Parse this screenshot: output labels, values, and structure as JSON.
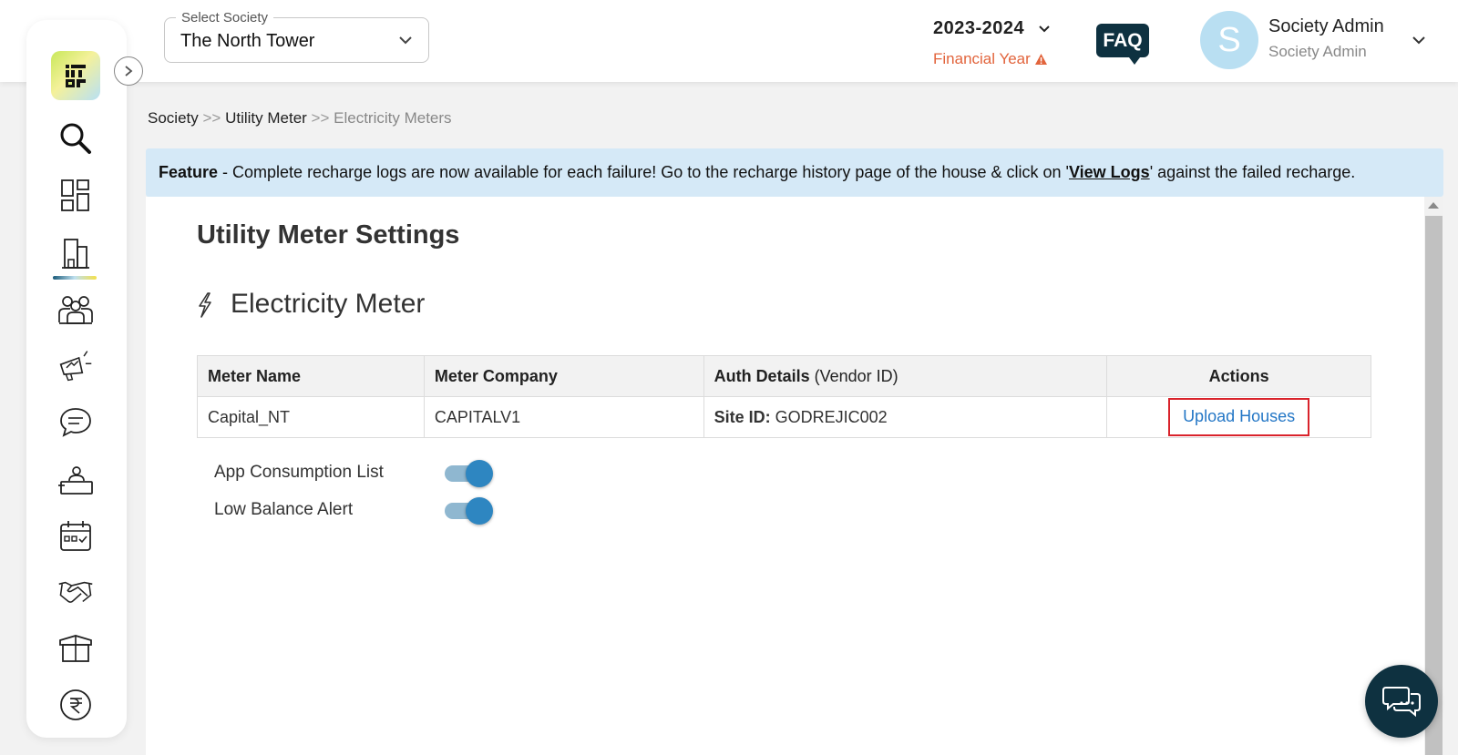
{
  "header": {
    "society_select": {
      "legend": "Select Society",
      "value": "The North Tower"
    },
    "financial_year": {
      "value": "2023-2024",
      "label": "Financial Year"
    },
    "faq_label": "FAQ",
    "user": {
      "initial": "S",
      "name": "Society Admin",
      "role": "Society Admin"
    }
  },
  "sidebar": {
    "items": [
      {
        "icon": "search-icon"
      },
      {
        "icon": "dashboard-icon"
      },
      {
        "icon": "building-icon",
        "active": true
      },
      {
        "icon": "people-icon"
      },
      {
        "icon": "megaphone-icon"
      },
      {
        "icon": "chat-icon"
      },
      {
        "icon": "reception-icon"
      },
      {
        "icon": "calendar-icon"
      },
      {
        "icon": "handshake-icon"
      },
      {
        "icon": "box-icon"
      },
      {
        "icon": "rupee-icon"
      }
    ]
  },
  "breadcrumb": {
    "items": [
      "Society",
      "Utility Meter",
      "Electricity Meters"
    ],
    "separator": ">>"
  },
  "banner": {
    "prefix": "Feature",
    "text_before": " - Complete recharge logs are now available for each failure! Go to the recharge history page of the house & click on '",
    "link": "View Logs",
    "text_after": "' against the failed recharge."
  },
  "page": {
    "title": "Utility Meter Settings",
    "section_title": "Electricity Meter"
  },
  "table": {
    "headers": {
      "meter_name": "Meter Name",
      "meter_company": "Meter Company",
      "auth_details": "Auth Details",
      "auth_details_suffix": "(Vendor ID)",
      "actions": "Actions"
    },
    "rows": [
      {
        "meter_name": "Capital_NT",
        "meter_company": "CAPITALV1",
        "site_label": "Site ID:",
        "site_id": "GODREJIC002",
        "action": "Upload Houses"
      }
    ]
  },
  "toggles": [
    {
      "label": "App Consumption List",
      "on": true
    },
    {
      "label": "Low Balance Alert",
      "on": true
    }
  ],
  "colors": {
    "accent": "#2e86c1",
    "brand_dark": "#0e3140",
    "warning": "#e2643c",
    "banner_bg": "#d5e9f7",
    "highlight": "#d9232b"
  }
}
